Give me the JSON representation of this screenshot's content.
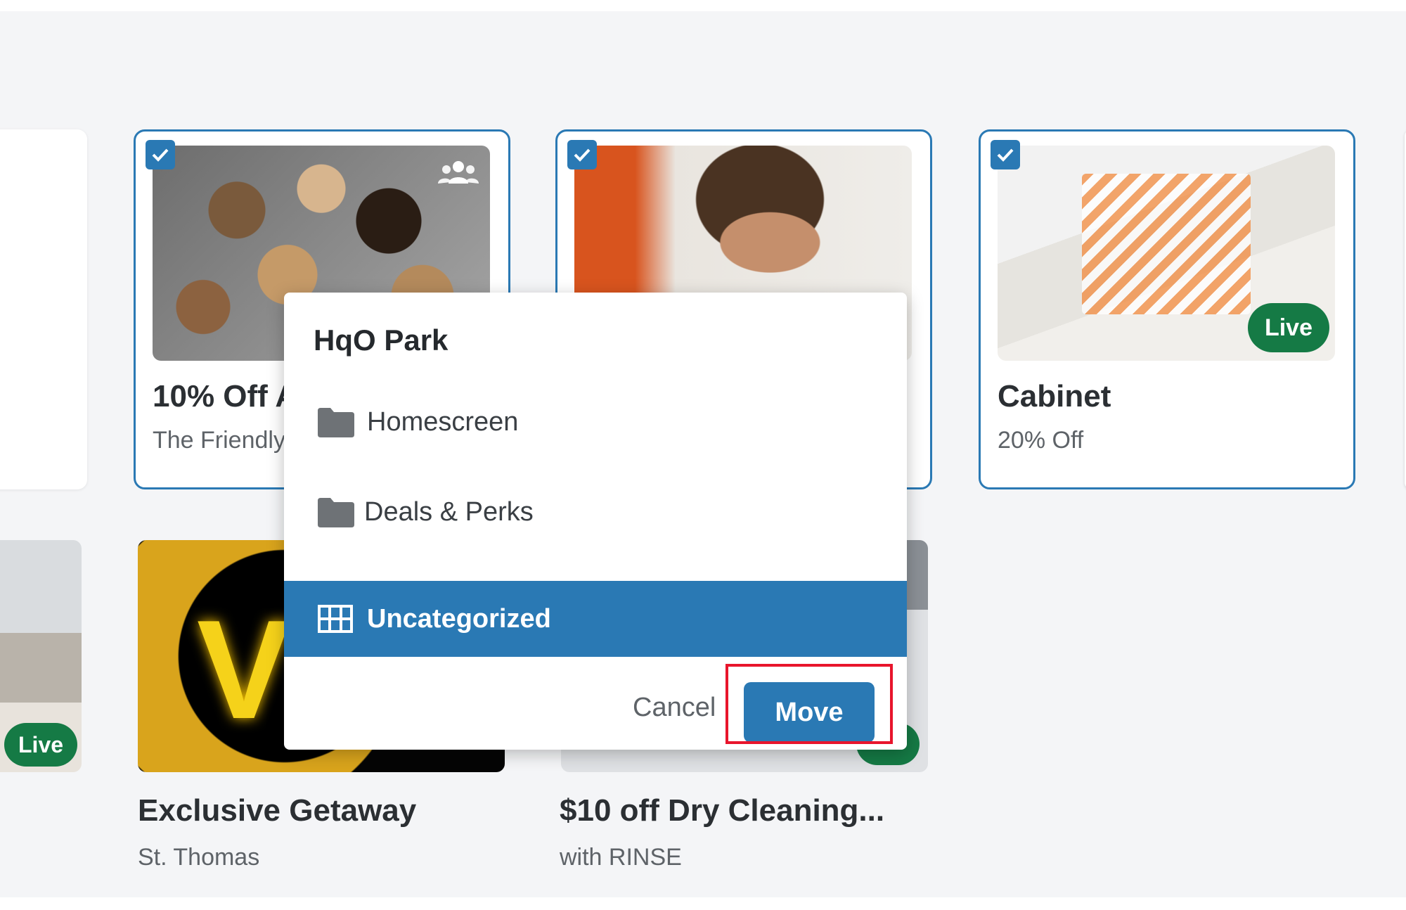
{
  "cards_row1": [
    {
      "title": "10% Off A",
      "subtitle": "The Friendly",
      "checked": true,
      "audience_icon": "group-icon"
    },
    {
      "title": "",
      "subtitle": "",
      "checked": true
    },
    {
      "title": "Cabinet",
      "subtitle": "20% Off",
      "checked": true,
      "status": "Live"
    }
  ],
  "cards_row2": [
    {
      "title": "",
      "subtitle": "",
      "status": "Live"
    },
    {
      "title": "Exclusive Getaway",
      "subtitle": "St. Thomas"
    },
    {
      "title": "$10 off Dry Cleaning...",
      "subtitle": "with RINSE"
    }
  ],
  "dialog": {
    "title": "HqO Park",
    "items": [
      {
        "label": "Homescreen",
        "icon": "folder-icon",
        "selected": false
      },
      {
        "label": "Deals & Perks",
        "icon": "folder-icon",
        "selected": false
      },
      {
        "label": "Uncategorized",
        "icon": "grid-icon",
        "selected": true
      }
    ],
    "cancel_label": "Cancel",
    "move_label": "Move"
  },
  "colors": {
    "accent": "#2a79b4",
    "live_badge": "#157a45",
    "highlight": "#e8152c",
    "background": "#f4f5f7"
  }
}
